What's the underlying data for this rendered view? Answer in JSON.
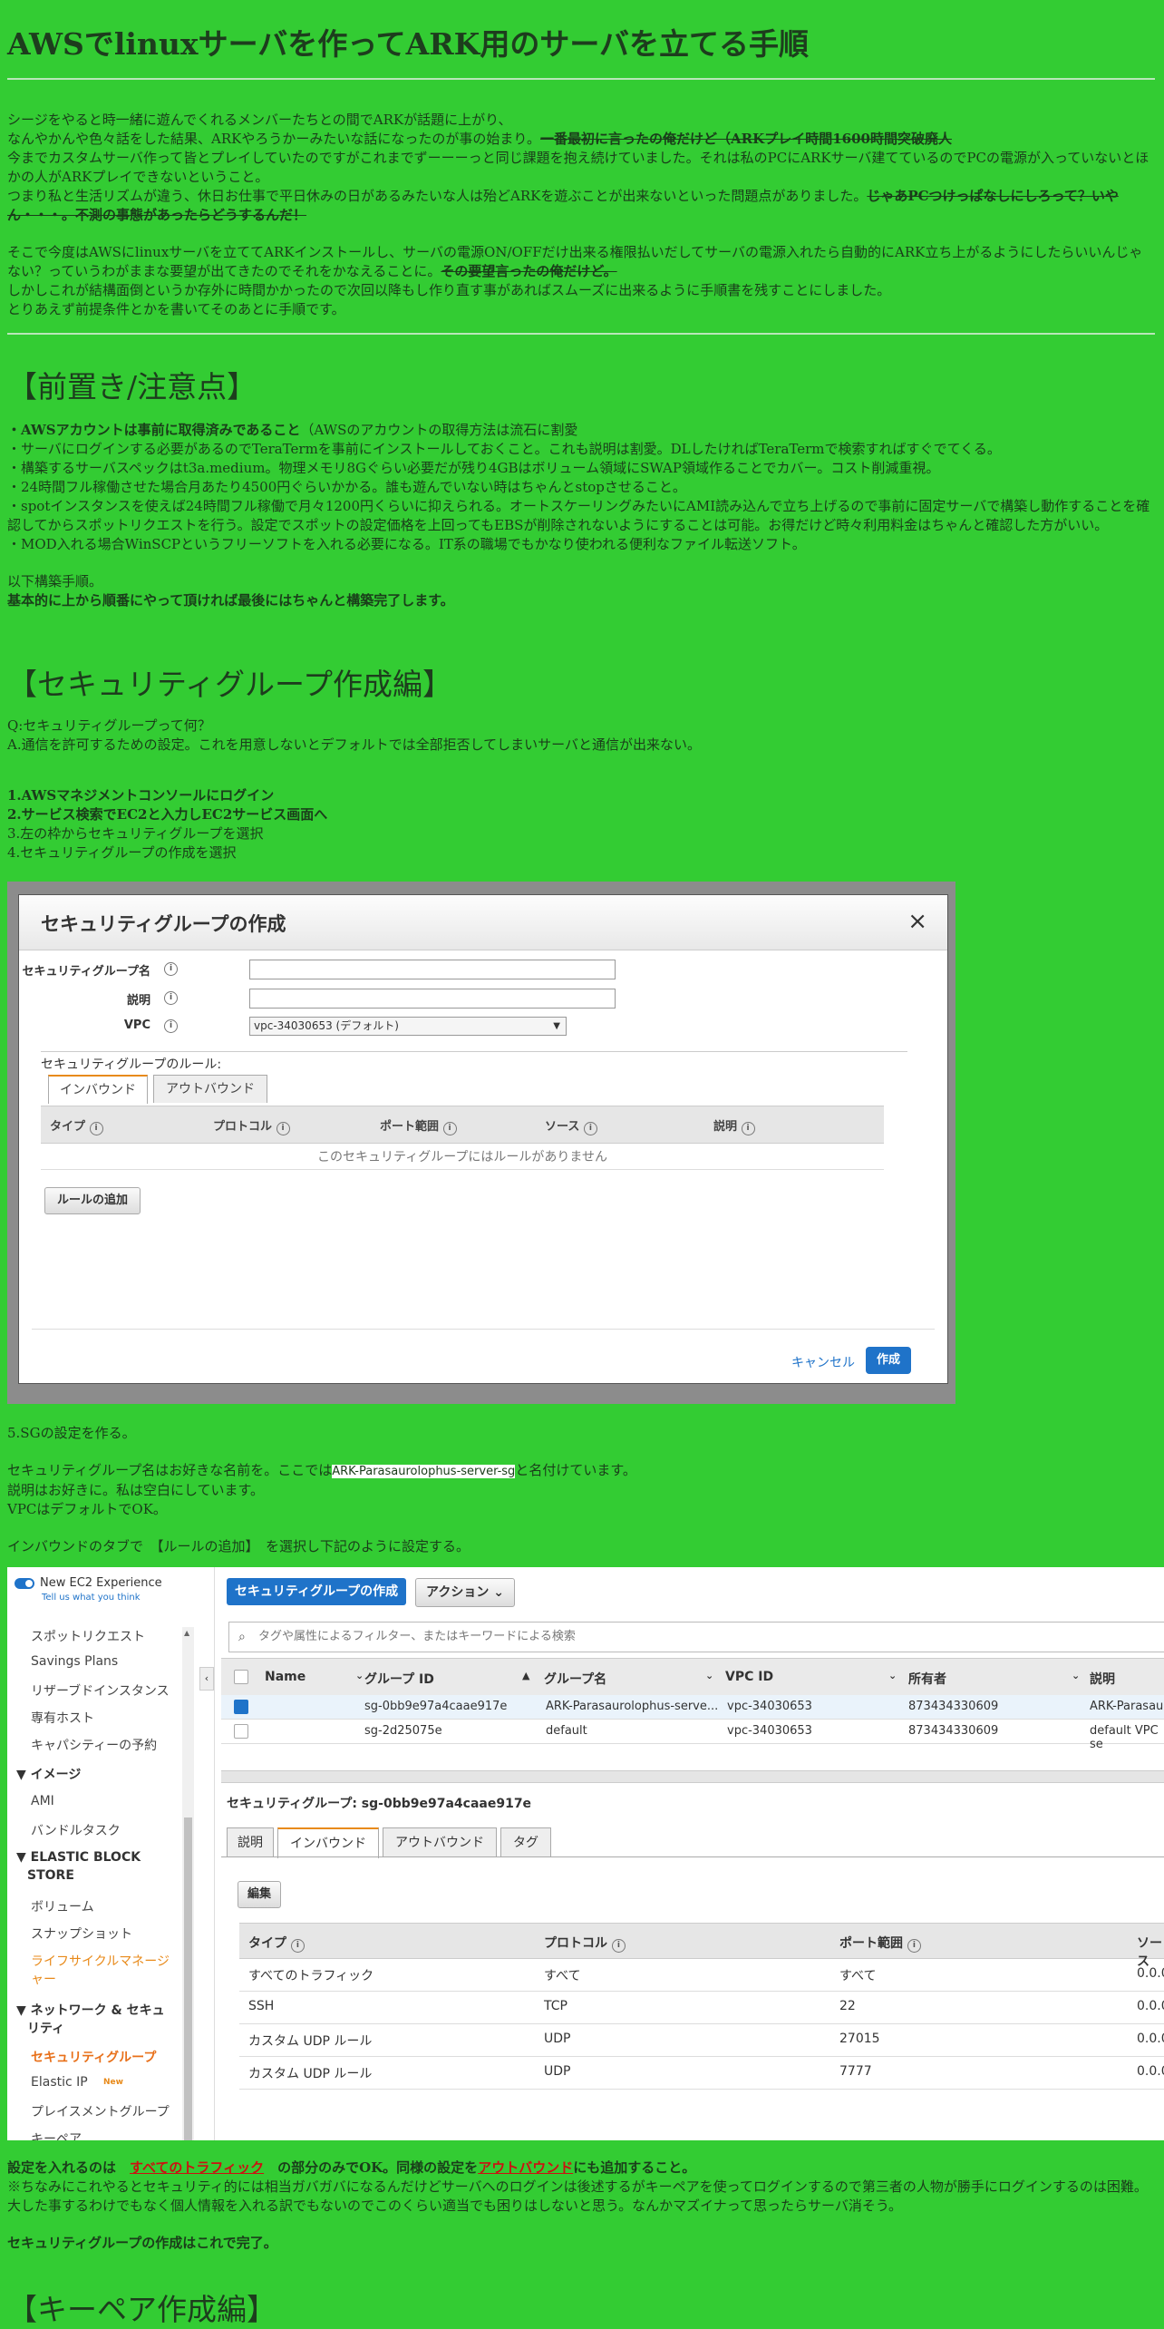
{
  "title": "AWSでlinuxサーバを作ってARK用のサーバを立てる手順",
  "intro": {
    "p1_lines": [
      "シージをやると時一緒に遊んでくれるメンバーたちとの間でARKが話題に上がり、"
    ],
    "p1_l2_normal": "なんやかんや色々話をした結果、ARKやろうかーみたいな話になったのが事の始まり。",
    "p1_l2_strike": "一番最初に言ったの俺だけど（ARKプレイ時間1600時間突破廃人",
    "p1_l3": "今までカスタムサーバ作って皆とプレイしていたのですがこれまでずーーーっと同じ課題を抱え続けていました。それは私のPCにARKサーバ建てているのでPCの電源が入っていないとほかの人がARKプレイできないということ。",
    "p1_l5_normal": "つまり私と生活リズムが違う、休日お仕事で平日休みの日があるみたいな人は殆どARKを遊ぶことが出来ないといった問題点がありました。",
    "p1_l5_strike": "じゃあPCつけっぱなしにしろって？いやん・・・。不測の事態があったらどうするんだ！",
    "p2_normal": "そこで今度はAWSにlinuxサーバを立ててARKインストールし、サーバの電源ON/OFFだけ出来る権限払いだしてサーバの電源入れたら自動的にARK立ち上がるようにしたらいいんじゃない？っていうわがままな要望が出てきたのでそれをかなえることに。",
    "p2_strike": "その要望言ったの俺だけど。",
    "p2_l3": "しかしこれが結構面倒というか存外に時間かかったので次回以降もし作り直す事があればスムーズに出来るように手順書を残すことにしました。",
    "p2_l4": "とりあえず前提条件とかを書いてそのあとに手順です。"
  },
  "prereq": {
    "heading": "【前置き/注意点】",
    "l1_bold": "・AWSアカウントは事前に取得済みであること",
    "l1_normal": "（AWSのアカウントの取得方法は流石に割愛",
    "l2": "・サーバにログインする必要があるのでTeraTermを事前にインストールしておくこと。これも説明は割愛。DLしたければTeraTermで検索すればすぐでてくる。",
    "l3": "・構築するサーバスペックはt3a.medium。物理メモリ8Gぐらい必要だが残り4GBはボリューム領域にSWAP領域作ることでカバー。コスト削減重視。",
    "l4": "・24時間フル稼働させた場合月あたり4500円ぐらいかかる。誰も遊んでいない時はちゃんとstopさせること。",
    "l5": "・spotインスタンスを使えば24時間フル稼働で月々1200円くらいに抑えられる。オートスケーリングみたいにAMI読み込んで立ち上げるので事前に固定サーバで構築し動作することを確認してからスポットリクエストを行う。設定でスポットの設定価格を上回ってもEBSが削除されないようにすることは可能。お得だけど時々利用料金はちゃんと確認した方がいい。",
    "l6": "・MOD入れる場合WinSCPというフリーソフトを入れる必要になる。IT系の職場でもかなり使われる便利なファイル転送ソフト。",
    "l7": "以下構築手順。",
    "l8_bold": "基本的に上から順番にやって頂ければ最後にはちゃんと構築完了します。"
  },
  "sg_section": {
    "heading": "【セキュリティグループ作成編】",
    "q": "Q:セキュリティグループって何？",
    "a": "A.通信を許可するための設定。これを用意しないとデフォルトでは全部拒否してしまいサーバと通信が出来ない。",
    "steps": [
      {
        "text": "1.AWSマネジメントコンソールにログイン",
        "bold": true
      },
      {
        "text": "2.サービス検索でEC2と入力しEC2サービス画面へ",
        "bold": true
      },
      {
        "text": "3.左の枠からセキュリティグループを選択",
        "bold": false
      },
      {
        "text": "4.セキュリティグループの作成を選択",
        "bold": false
      }
    ]
  },
  "modal": {
    "title": "セキュリティグループの作成",
    "close": "×",
    "label_name": "セキュリティグループ名",
    "label_desc": "説明",
    "label_vpc": "VPC",
    "info": "i",
    "vpc_value": "vpc-34030653 (デフォルト)",
    "rules_label": "セキュリティグループのルール:",
    "tab_inbound": "インバウンド",
    "tab_outbound": "アウトバウンド",
    "cols": [
      "タイプ",
      "プロトコル",
      "ポート範囲",
      "ソース",
      "説明"
    ],
    "empty": "このセキュリティグループにはルールがありません",
    "add_rule": "ルールの追加",
    "cancel": "キャンセル",
    "create": "作成"
  },
  "after_modal": {
    "step5": "5.SGの設定を作る。",
    "name_pre": "セキュリティグループ名はお好きな名前を。ここでは",
    "name_hl": "ARK-Parasaurolophus-server-sg",
    "name_post": "と名付けています。",
    "desc": "説明はお好きに。私は空白にしています。",
    "vpc": "VPCはデフォルトでOK。",
    "inbound": "インバウンドのタブで　【ルールの追加】　を選択し下記のように設定する。"
  },
  "console": {
    "new_exp": "New EC2 Experience",
    "tell_us": "Tell us what you think",
    "sidebar": [
      {
        "t": "スポットリクエスト",
        "k": "item"
      },
      {
        "t": "Savings Plans",
        "k": "item"
      },
      {
        "t": "リザーブドインスタンス",
        "k": "item"
      },
      {
        "t": "専有ホスト",
        "k": "item"
      },
      {
        "t": "キャパシティーの予約",
        "k": "item"
      },
      {
        "t": "▼ イメージ",
        "k": "sec"
      },
      {
        "t": "AMI",
        "k": "item"
      },
      {
        "t": "バンドルタスク",
        "k": "item"
      },
      {
        "t": "▼ ELASTIC BLOCK",
        "k": "sec"
      },
      {
        "t": "STORE",
        "k": "sec2"
      },
      {
        "t": "ボリューム",
        "k": "item"
      },
      {
        "t": "スナップショット",
        "k": "item"
      },
      {
        "t": "ライフサイクルマネージ",
        "k": "orange"
      },
      {
        "t": "ャー",
        "k": "orange"
      },
      {
        "t": "▼ ネットワーク & セキュ",
        "k": "sec"
      },
      {
        "t": "リティ",
        "k": "sec2"
      },
      {
        "t": "セキュリティグループ",
        "k": "active"
      },
      {
        "t": "Elastic IP",
        "k": "item"
      },
      {
        "t": "プレイスメントグループ",
        "k": "item"
      },
      {
        "t": "キーペア",
        "k": "item"
      }
    ],
    "new_badge": "New",
    "create_btn": "セキュリティグループの作成",
    "action_btn": "アクション ⌄",
    "search_ph": "タグや属性によるフィルター、またはキーワードによる検索",
    "grid_cols": [
      "Name",
      "グループ ID",
      "グループ名",
      "VPC ID",
      "所有者",
      "説明"
    ],
    "rows": [
      {
        "id": "sg-0bb9e97a4caae917e",
        "name": "ARK-Parasaurolophus-serve...",
        "vpc": "vpc-34030653",
        "owner": "873434330609",
        "desc": "ARK-Parasau"
      },
      {
        "id": "sg-2d25075e",
        "name": "default",
        "vpc": "vpc-34030653",
        "owner": "873434330609",
        "desc": "default VPC se"
      }
    ],
    "detail_title": "セキュリティグループ: sg-0bb9e97a4caae917e",
    "tabs": [
      "説明",
      "インバウンド",
      "アウトバウンド",
      "タグ"
    ],
    "edit_btn": "編集",
    "rule_cols": [
      "タイプ",
      "プロトコル",
      "ポート範囲",
      "ソース"
    ],
    "rules": [
      {
        "type": "すべてのトラフィック",
        "proto": "すべて",
        "port": "すべて",
        "src": "0.0.0."
      },
      {
        "type": "SSH",
        "proto": "TCP",
        "port": "22",
        "src": "0.0.0."
      },
      {
        "type": "カスタム UDP ルール",
        "proto": "UDP",
        "port": "27015",
        "src": "0.0.0."
      },
      {
        "type": "カスタム UDP ルール",
        "proto": "UDP",
        "port": "7777",
        "src": "0.0.0."
      }
    ]
  },
  "footer_text": {
    "l1_pre": "設定を入れるのは　",
    "l1_link": "すべてのトラフィック",
    "l1_mid": "　の部分のみでOK。同様の設定を",
    "l1_link2": "アウトバウンド",
    "l1_post": "にも追加すること。",
    "l2": "※ちなみにこれやるとセキュリティ的には相当ガバガバになるんだけどサーバへのログインは後述するがキーペアを使ってログインするので第三者の人物が勝手にログインするのは困難。大した事するわけでもなく個人情報を入れる訳でもないのでこのくらい適当でも困りはしないと思う。なんかマズイナって思ったらサーバ消そう。",
    "l3": "セキュリティグループの作成はこれで完了。",
    "next_heading": "【キーペア作成編】"
  }
}
